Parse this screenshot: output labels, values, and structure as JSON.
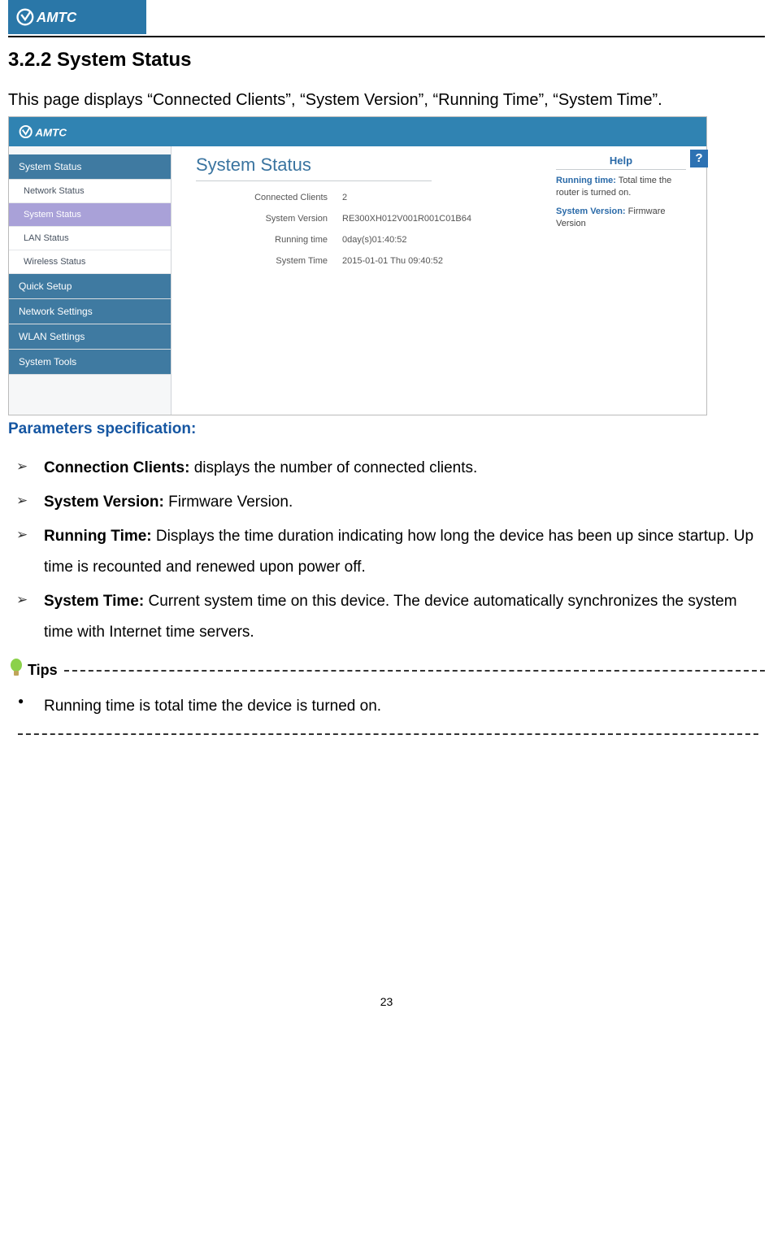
{
  "brand": "AMTC",
  "section_title": "3.2.2 System Status",
  "intro_text": "This page displays “Connected Clients”, “System Version”, “Running Time”, “System Time”.",
  "router_ui": {
    "sidebar": {
      "items": [
        {
          "label": "System Status",
          "kind": "top"
        },
        {
          "label": "Network Status",
          "kind": "sub"
        },
        {
          "label": "System Status",
          "kind": "sub-active"
        },
        {
          "label": "LAN Status",
          "kind": "sub"
        },
        {
          "label": "Wireless Status",
          "kind": "sub"
        },
        {
          "label": "Quick Setup",
          "kind": "group"
        },
        {
          "label": "Network Settings",
          "kind": "group"
        },
        {
          "label": "WLAN Settings",
          "kind": "group"
        },
        {
          "label": "System Tools",
          "kind": "group"
        }
      ]
    },
    "main": {
      "title": "System Status",
      "rows": [
        {
          "label": "Connected Clients",
          "value": "2"
        },
        {
          "label": "System Version",
          "value": "RE300XH012V001R001C01B64"
        },
        {
          "label": "Running time",
          "value": "0day(s)01:40:52"
        },
        {
          "label": "System Time",
          "value": "2015-01-01 Thu 09:40:52"
        }
      ]
    },
    "help": {
      "title": "Help",
      "entries": [
        {
          "term": "Running time:",
          "desc": "Total time the router is turned on."
        },
        {
          "term": "System Version:",
          "desc": "Firmware Version"
        }
      ],
      "badge": "?"
    }
  },
  "params_heading": "Parameters specification:",
  "params": [
    {
      "term": "Connection Clients:",
      "desc": " displays the number of connected clients."
    },
    {
      "term": "System Version:",
      "desc": " Firmware Version."
    },
    {
      "term": "Running Time:",
      "desc": " Displays the time duration indicating how long the device has been up since startup. Up time is recounted and renewed upon power off."
    },
    {
      "term": "System Time:",
      "desc": " Current system time on this device. The device automatically synchronizes the system time with Internet time servers."
    }
  ],
  "tips_label": "Tips",
  "tips": [
    "Running time is total time the device is turned on."
  ],
  "page_number": "23"
}
